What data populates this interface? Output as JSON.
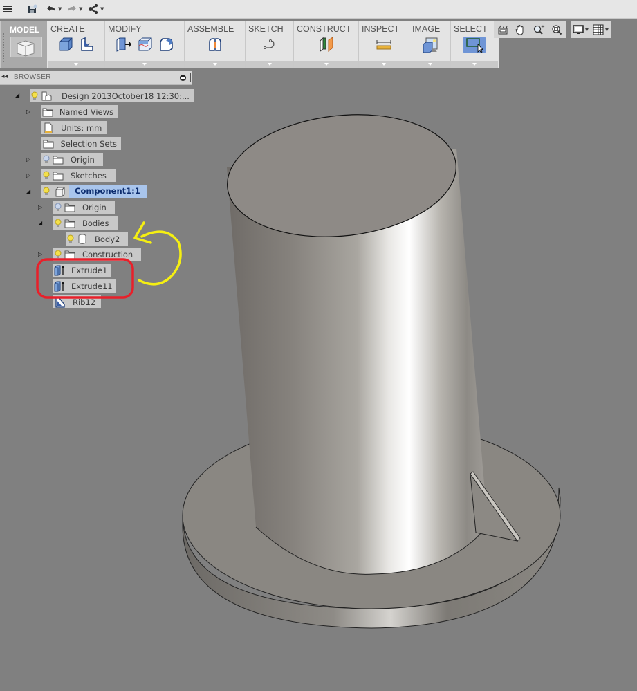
{
  "quick_access": {
    "icons": [
      "menu-icon",
      "save-icon",
      "undo-icon",
      "redo-icon",
      "share-icon"
    ]
  },
  "ribbon": {
    "workspace": "MODEL",
    "groups": [
      {
        "label": "CREATE",
        "icons": [
          "box-icon",
          "sketch-shape-icon"
        ]
      },
      {
        "label": "MODIFY",
        "icons": [
          "press-pull-icon",
          "split-face-icon",
          "fillet-icon"
        ]
      },
      {
        "label": "ASSEMBLE",
        "icons": [
          "joint-icon"
        ]
      },
      {
        "label": "SKETCH",
        "icons": [
          "spline-icon"
        ]
      },
      {
        "label": "CONSTRUCT",
        "icons": [
          "plane-icon"
        ]
      },
      {
        "label": "INSPECT",
        "icons": [
          "measure-icon"
        ]
      },
      {
        "label": "IMAGE",
        "icons": [
          "render-icon"
        ]
      },
      {
        "label": "SELECT",
        "icons": [
          "window-select-icon"
        ]
      }
    ]
  },
  "nav_toolbar": [
    "look-at-icon",
    "pan-icon",
    "zoom-icon",
    "zoom-window-icon"
  ],
  "display_toolbar": [
    "display-settings-icon",
    "grid-icon"
  ],
  "browser": {
    "title": "BROWSER",
    "tree": [
      {
        "label": "Design 2013October18 12:30:...",
        "level": 0,
        "expanded": true,
        "bulb": "on",
        "icon": "design-icon"
      },
      {
        "label": "Named Views",
        "level": 1,
        "expanded": false,
        "icon": "folder-icon"
      },
      {
        "label": "Units: mm",
        "level": 1,
        "icon": "units-icon"
      },
      {
        "label": "Selection Sets",
        "level": 1,
        "icon": "folder-icon"
      },
      {
        "label": "Origin",
        "level": 1,
        "expanded": false,
        "bulb": "off",
        "icon": "folder-icon"
      },
      {
        "label": "Sketches",
        "level": 1,
        "expanded": false,
        "bulb": "on",
        "icon": "folder-icon"
      },
      {
        "label": "Component1:1",
        "level": 1,
        "expanded": true,
        "bulb": "on",
        "icon": "component-icon",
        "selected": true
      },
      {
        "label": "Origin",
        "level": 2,
        "expanded": false,
        "bulb": "off",
        "icon": "folder-icon"
      },
      {
        "label": "Bodies",
        "level": 2,
        "expanded": true,
        "bulb": "on",
        "icon": "folder-icon"
      },
      {
        "label": "Body2",
        "level": 3,
        "bulb": "on",
        "icon": "body-icon"
      },
      {
        "label": "Construction",
        "level": 2,
        "expanded": false,
        "bulb": "on",
        "icon": "folder-icon"
      },
      {
        "label": "Extrude1",
        "level": 2,
        "icon": "extrude-icon"
      },
      {
        "label": "Extrude11",
        "level": 2,
        "icon": "extrude-icon"
      },
      {
        "label": "Rib12",
        "level": 2,
        "icon": "rib-icon"
      }
    ]
  },
  "annotations": {
    "red_box_color": "#e8202a",
    "yellow_arrow_color": "#f5ef12"
  },
  "viewport": {
    "background": "#808080",
    "model": "cylinder-on-flange-with-rib"
  }
}
